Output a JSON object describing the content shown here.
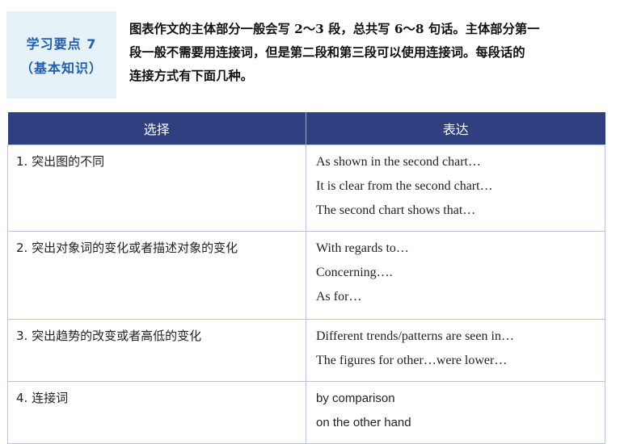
{
  "badge": {
    "line1": "学习要点 7",
    "line2": "（基本知识）"
  },
  "intro": {
    "lines": [
      "图表作文的主体部分一般会写 2～3 段，总共写 6～8 句话。主体部分第一",
      "段一般不需要用连接词，但是第二段和第三段可以使用连接词。每段话的",
      "连接方式有下面几种。"
    ]
  },
  "table": {
    "headers": [
      "选择",
      "表达"
    ],
    "rows": [
      {
        "choice": "1. 突出图的不同",
        "expressions": [
          "As shown in the second chart…",
          "It is clear from the second chart…",
          "The second chart shows that…"
        ]
      },
      {
        "choice": "2. 突出对象词的变化或者描述对象的变化",
        "expressions": [
          "With regards to…",
          "Concerning….",
          "As for…"
        ]
      },
      {
        "choice": "3. 突出趋势的改变或者高低的变化",
        "expressions": [
          "Different trends/patterns are seen in…",
          "The figures for other…were lower…"
        ]
      },
      {
        "choice": "4. 连接词",
        "expressions": [
          "by comparison",
          "on the other hand"
        ]
      }
    ]
  }
}
